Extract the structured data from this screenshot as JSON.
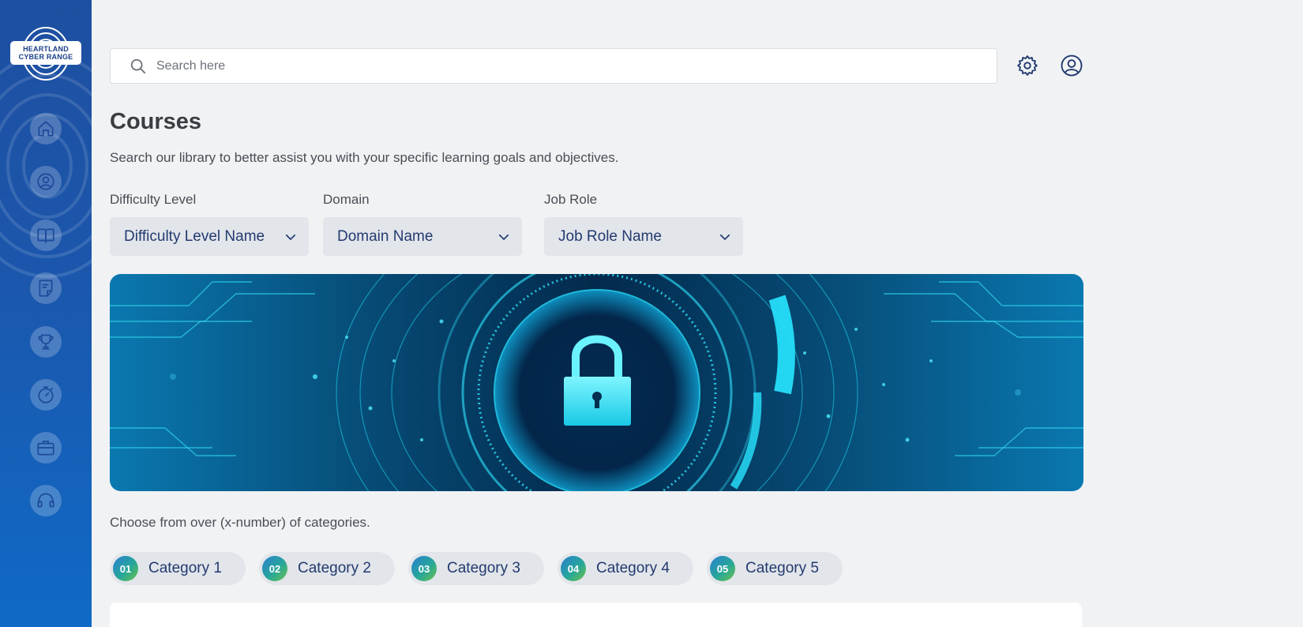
{
  "brand": {
    "line1": "HEARTLAND",
    "line2": "CYBER RANGE",
    "accent_color": "#1b57ad"
  },
  "sidebar": {
    "items": [
      {
        "name": "home",
        "icon": "home-icon"
      },
      {
        "name": "profile",
        "icon": "user-icon"
      },
      {
        "name": "courses",
        "icon": "book-icon"
      },
      {
        "name": "documents",
        "icon": "document-icon"
      },
      {
        "name": "achievements",
        "icon": "trophy-icon"
      },
      {
        "name": "timer",
        "icon": "stopwatch-icon"
      },
      {
        "name": "jobs",
        "icon": "briefcase-icon"
      },
      {
        "name": "support",
        "icon": "headset-icon"
      }
    ]
  },
  "search": {
    "placeholder": "Search here",
    "value": ""
  },
  "header_icons": [
    "gear-icon",
    "user-icon"
  ],
  "page": {
    "title": "Courses",
    "subtitle": "Search our library to better assist you with your specific learning goals and objectives."
  },
  "filters": [
    {
      "label": "Difficulty Level",
      "value": "Difficulty Level Name"
    },
    {
      "label": "Domain",
      "value": "Domain Name"
    },
    {
      "label": "Job Role",
      "value": "Job Role Name"
    }
  ],
  "banner": {
    "icon": "padlock-icon",
    "colors": {
      "dark": "#0a3d6b",
      "glow": "#18d4f0"
    }
  },
  "categories": {
    "intro": "Choose from over (x-number) of categories.",
    "items": [
      {
        "num": "01",
        "label": "Category 1"
      },
      {
        "num": "02",
        "label": "Category 2"
      },
      {
        "num": "03",
        "label": "Category 3"
      },
      {
        "num": "04",
        "label": "Category 4"
      },
      {
        "num": "05",
        "label": "Category 5"
      }
    ]
  }
}
